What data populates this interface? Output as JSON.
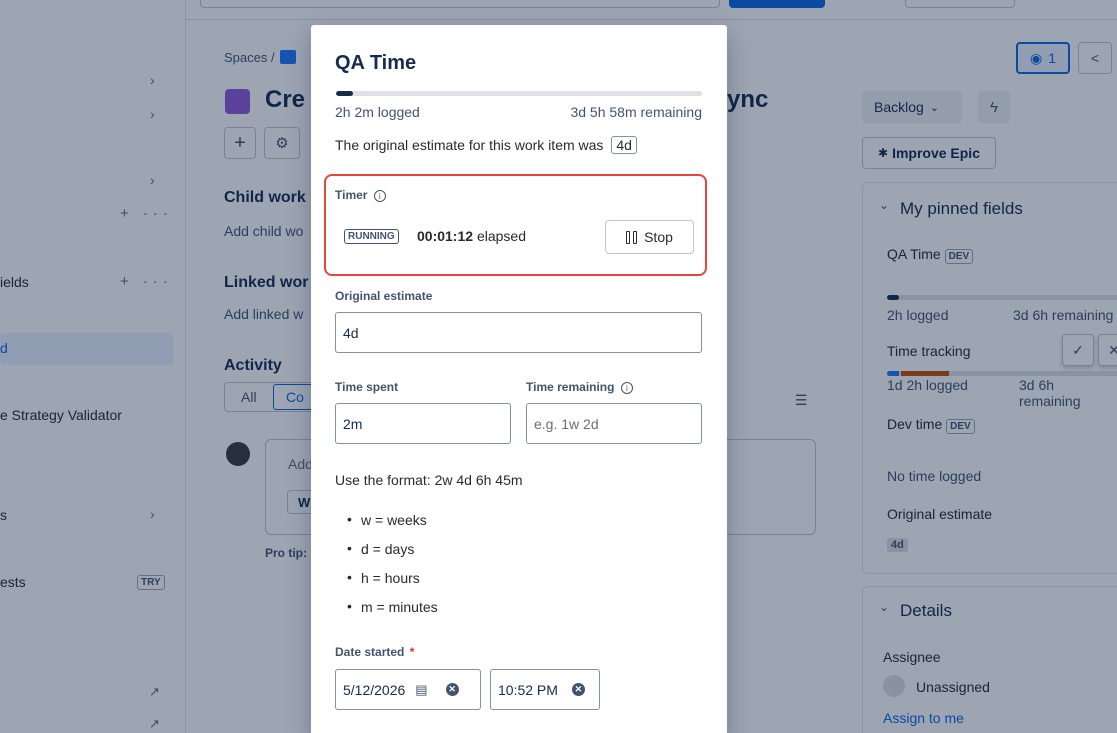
{
  "sidebar": {
    "items": [
      {
        "label": "ields"
      },
      {
        "label": "d"
      },
      {
        "label": "e Strategy Validator"
      },
      {
        "label": "s"
      },
      {
        "label": "ests",
        "badge": "TRY"
      }
    ]
  },
  "breadcrumb": {
    "spaces": "Spaces",
    "sep": "/"
  },
  "issue": {
    "title_left": "Cre",
    "title_right": "ync"
  },
  "sections": {
    "child_work": "Child work",
    "add_child": "Add child wo",
    "linked_work": "Linked wor",
    "add_linked": "Add linked w",
    "activity": "Activity",
    "tab_all": "All",
    "tab_comments": "Co",
    "comment_placeholder": "Add",
    "comment_btn": "W",
    "pro_tip": "Pro tip:"
  },
  "right_panel": {
    "watch_count": "1",
    "status": "Backlog",
    "improve_epic": "Improve Epic",
    "pinned_title": "My pinned fields",
    "qa_time_label": "QA Time",
    "qa_badge": "DEV",
    "qa_logged": "2h logged",
    "qa_remaining": "3d 6h remaining",
    "time_tracking_label": "Time tracking",
    "tt_logged": "1d 2h logged",
    "tt_remaining": "3d 6h remaining",
    "dev_time_label": "Dev time",
    "dev_badge": "DEV",
    "no_time": "No time logged",
    "orig_est_label": "Original estimate",
    "orig_est_value": "4d",
    "details_title": "Details",
    "assignee_label": "Assignee",
    "assignee_value": "Unassigned",
    "assign_to_me": "Assign to me"
  },
  "modal": {
    "title": "QA Time",
    "progress_fraction": 0.047,
    "logged": "2h 2m logged",
    "remaining": "3d 5h 58m remaining",
    "original_text": "The original estimate for this work item was",
    "original_value": "4d",
    "timer": {
      "label": "Timer",
      "status": "RUNNING",
      "elapsed_value": "00:01:12",
      "elapsed_text": "elapsed",
      "stop_label": "Stop",
      "highlight_color": "#e2483d"
    },
    "original_estimate_label": "Original estimate",
    "original_estimate_value": "4d",
    "time_spent_label": "Time spent",
    "time_spent_value": "2m",
    "time_remaining_label": "Time remaining",
    "time_remaining_placeholder": "e.g. 1w 2d",
    "format_hint": "Use the format: 2w 4d 6h 45m",
    "units": [
      "w = weeks",
      "d = days",
      "h = hours",
      "m = minutes"
    ],
    "date_started_label": "Date started",
    "required_mark": "*",
    "date_value": "5/12/2026",
    "time_value": "10:52 PM"
  },
  "colors": {
    "accent": "#0c66e4",
    "epic": "#8f5ad6",
    "required": "#c9372c"
  }
}
